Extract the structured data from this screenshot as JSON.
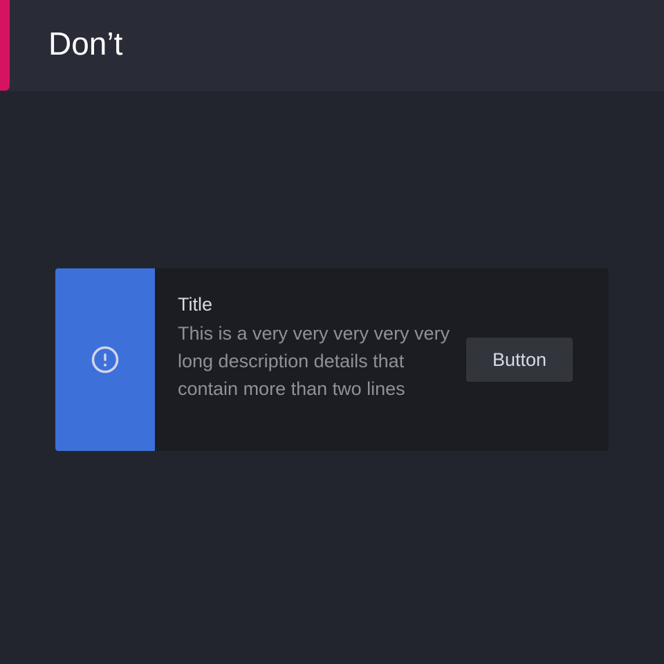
{
  "header": {
    "title": "Don’t"
  },
  "banner": {
    "icon": "info-circle-icon",
    "title": "Title",
    "description": "This is a very very very very very long description details that contain more than two lines",
    "button_label": "Button"
  },
  "colors": {
    "background": "#22252e",
    "header_background": "#292c36",
    "header_accent": "#d61361",
    "banner_background": "#1b1d22",
    "banner_side": "#3d71d9",
    "button_background": "#33353c"
  }
}
